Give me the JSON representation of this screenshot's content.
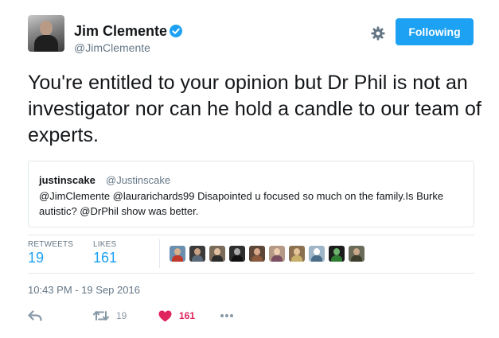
{
  "author": {
    "name": "Jim Clemente",
    "handle": "@JimClemente",
    "avatar_icon": "avatar",
    "verified_icon": "verified-badge-icon"
  },
  "header_actions": {
    "settings_icon": "gear-icon",
    "follow_label": "Following",
    "follow_color": "#1da1f2"
  },
  "tweet": {
    "text": "You're entitled to your opinion but Dr Phil is not an investigator nor can he hold a candle to our team of experts."
  },
  "quoted_tweet": {
    "name": "justinscake",
    "handle": "@Justinscake",
    "text": "@JimClemente @laurarichards99 Disapointed u focused so much on the family.Is Burke autistic? @DrPhil show was better."
  },
  "stats": {
    "retweets_label": "RETWEETS",
    "retweets_value": "19",
    "likes_label": "LIKES",
    "likes_value": "161",
    "liker_count_shown": 10
  },
  "timestamp": "10:43 PM - 19 Sep 2016",
  "actions": {
    "reply_icon": "reply-icon",
    "retweet_icon": "retweet-icon",
    "retweet_count": "19",
    "like_icon": "heart-icon",
    "like_count": "161",
    "like_color": "#e0245e",
    "more_icon": "more-dots-icon"
  },
  "colors": {
    "text": "#14171a",
    "secondary": "#657786",
    "accent": "#1da1f2",
    "border": "#e1e8ed"
  }
}
